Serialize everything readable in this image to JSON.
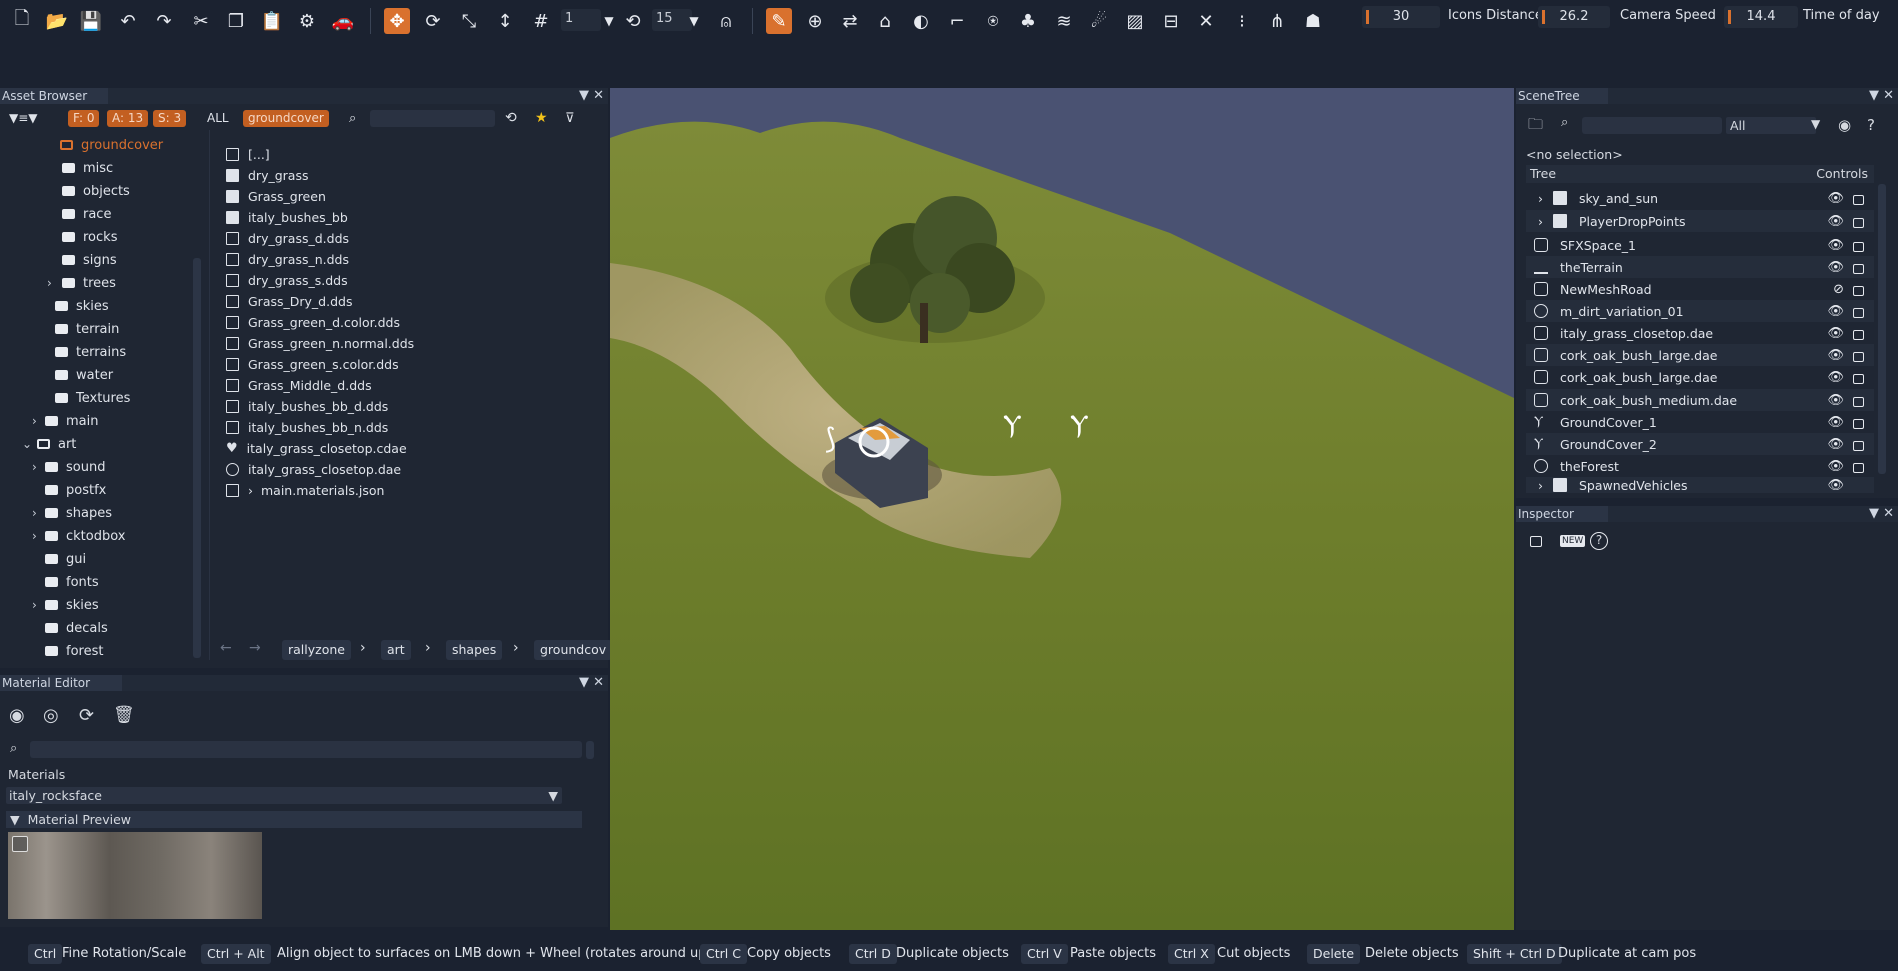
{
  "toolbar": {
    "rotation_step_value": "1",
    "snap_angle_value": "15",
    "icons_distance_value": "30",
    "icons_distance_label": "Icons Distance",
    "camera_speed_value": "26.2",
    "camera_speed_label": "Camera Speed",
    "time_of_day_value": "14.4",
    "time_of_day_label": "Time of day"
  },
  "asset_browser": {
    "title": "Asset Browser",
    "filter_f": "F: 0",
    "filter_a": "A: 13",
    "filter_s": "S: 3",
    "filter_all": "ALL",
    "filter_active": "groundcover",
    "folders": [
      {
        "label": "groundcover",
        "selected": true
      },
      {
        "label": "misc"
      },
      {
        "label": "objects"
      },
      {
        "label": "race"
      },
      {
        "label": "rocks"
      },
      {
        "label": "signs"
      },
      {
        "label": "trees"
      },
      {
        "label": "skies"
      },
      {
        "label": "terrain"
      },
      {
        "label": "terrains"
      },
      {
        "label": "water"
      },
      {
        "label": "Textures"
      },
      {
        "label": "main"
      },
      {
        "label": "art"
      },
      {
        "label": "sound"
      },
      {
        "label": "postfx"
      },
      {
        "label": "shapes"
      },
      {
        "label": "cktodbox"
      },
      {
        "label": "gui"
      },
      {
        "label": "fonts"
      },
      {
        "label": "skies"
      },
      {
        "label": "decals"
      },
      {
        "label": "forest"
      }
    ],
    "files": [
      "[...]",
      "dry_grass",
      "Grass_green",
      "italy_bushes_bb",
      "dry_grass_d.dds",
      "dry_grass_n.dds",
      "dry_grass_s.dds",
      "Grass_Dry_d.dds",
      "Grass_green_d.color.dds",
      "Grass_green_n.normal.dds",
      "Grass_green_s.color.dds",
      "Grass_Middle_d.dds",
      "italy_bushes_bb_d.dds",
      "italy_bushes_bb_n.dds",
      "italy_grass_closetop.cdae",
      "italy_grass_closetop.dae",
      "main.materials.json"
    ],
    "breadcrumb": [
      "rallyzone",
      "art",
      "shapes",
      "groundcov"
    ]
  },
  "material_editor": {
    "title": "Material Editor",
    "materials_label": "Materials",
    "selected_material": "italy_rocksface",
    "preview_label": "Material Preview"
  },
  "scene_tree": {
    "title": "SceneTree",
    "filter_value": "All",
    "selection_text": "<no selection>",
    "col_tree": "Tree",
    "col_controls": "Controls",
    "items": [
      "sky_and_sun",
      "PlayerDropPoints",
      "SFXSpace_1",
      "theTerrain",
      "NewMeshRoad",
      "m_dirt_variation_01",
      "italy_grass_closetop.dae",
      "cork_oak_bush_large.dae",
      "cork_oak_bush_large.dae",
      "cork_oak_bush_medium.dae",
      "GroundCover_1",
      "GroundCover_2",
      "theForest",
      "SpawnedVehicles"
    ]
  },
  "inspector": {
    "title": "Inspector"
  },
  "statusbar": [
    {
      "key": "Ctrl",
      "desc": "Fine Rotation/Scale"
    },
    {
      "key": "Ctrl + Alt",
      "desc": "Align object to surfaces on LMB down + Wheel (rotates around up axis)"
    },
    {
      "key": "Ctrl C",
      "desc": "Copy objects"
    },
    {
      "key": "Ctrl D",
      "desc": "Duplicate objects"
    },
    {
      "key": "Ctrl V",
      "desc": "Paste objects"
    },
    {
      "key": "Ctrl X",
      "desc": "Cut objects"
    },
    {
      "key": "Delete",
      "desc": "Delete objects"
    },
    {
      "key": "Shift + Ctrl D",
      "desc": "Duplicate at cam pos"
    }
  ],
  "colors": {
    "accent": "#d9712e",
    "background": "#1b2230",
    "panel": "#1f2633",
    "panel_title": "#2b3445"
  }
}
